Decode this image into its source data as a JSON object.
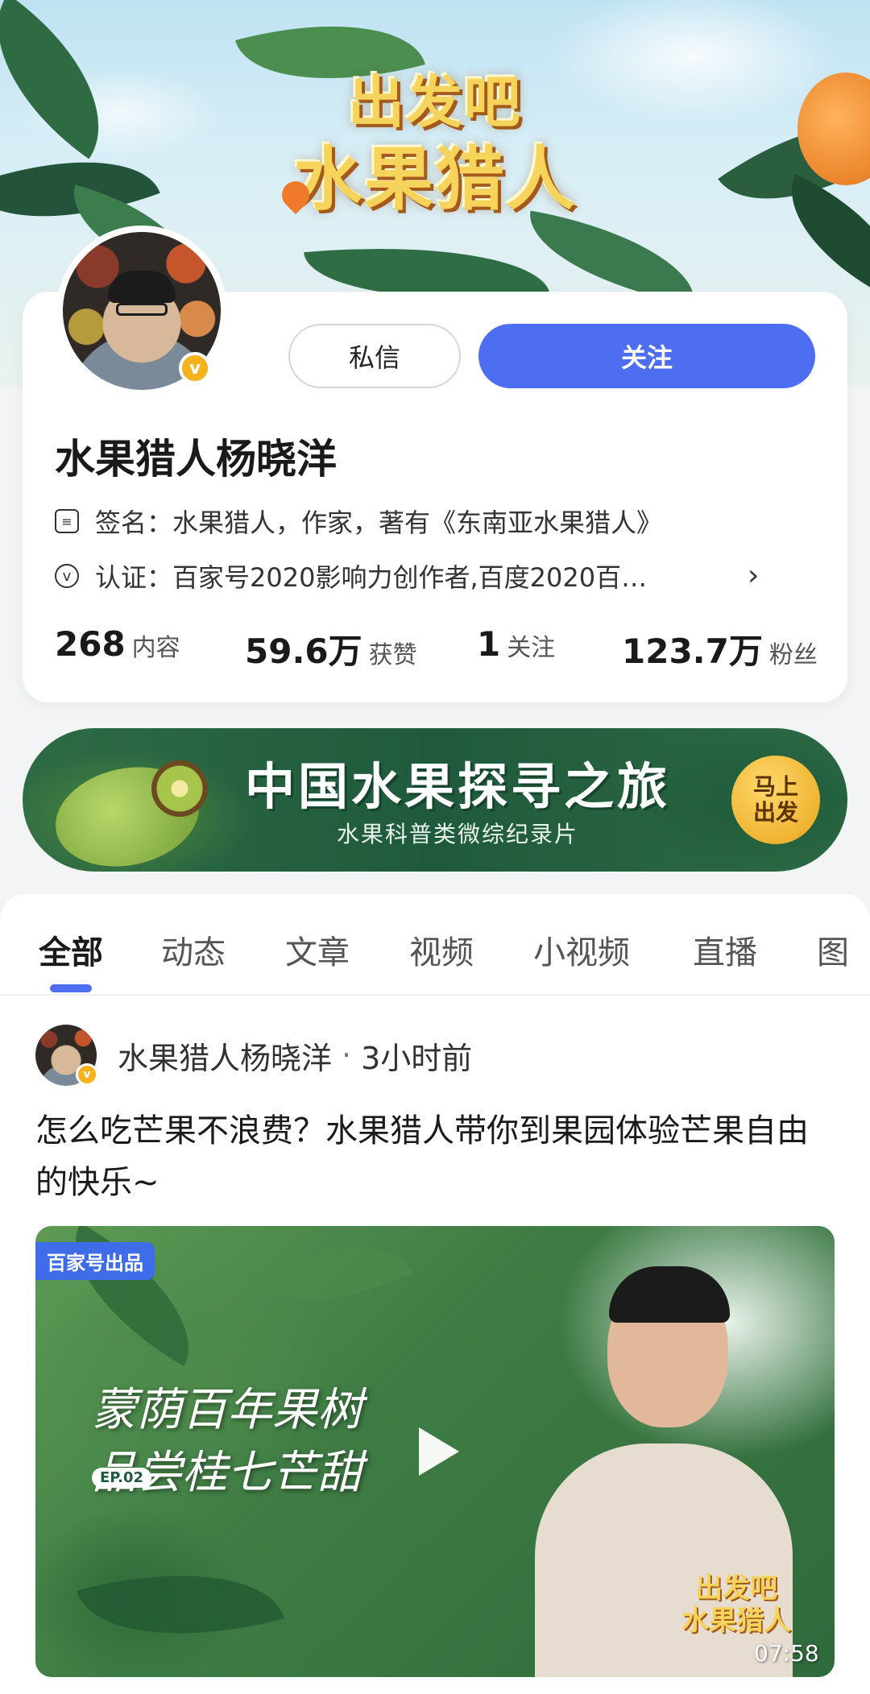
{
  "header": {
    "logo_line1": "出发吧",
    "logo_line2": "水果猎人"
  },
  "profile": {
    "message_button": "私信",
    "follow_button": "关注",
    "name": "水果猎人杨晓洋",
    "signature_label": "签名：",
    "signature_text": "水果猎人，作家，著有《东南亚水果猎人》",
    "cert_label": "认证：",
    "cert_text": "百家号2020影响力创作者,百度2020百…",
    "stats": [
      {
        "value": "268",
        "label": "内容"
      },
      {
        "value": "59.6万",
        "label": "获赞"
      },
      {
        "value": "1",
        "label": "关注"
      },
      {
        "value": "123.7万",
        "label": "粉丝"
      }
    ]
  },
  "promo": {
    "title": "中国水果探寻之旅",
    "subtitle": "水果科普类微综纪录片",
    "button_line1": "马上",
    "button_line2": "出发"
  },
  "tabs": [
    {
      "label": "全部",
      "active": true
    },
    {
      "label": "动态"
    },
    {
      "label": "文章"
    },
    {
      "label": "视频"
    },
    {
      "label": "小视频"
    },
    {
      "label": "直播"
    },
    {
      "label": "图"
    }
  ],
  "post": {
    "author": "水果猎人杨晓洋",
    "separator": "·",
    "time": "3小时前",
    "title": "怎么吃芒果不浪费？水果猎人带你到果园体验芒果自由的快乐~",
    "video": {
      "badge": "百家号出品",
      "caption_line1": "蒙荫百年果树",
      "caption_line2": "品尝桂七芒甜",
      "episode": "EP.02",
      "logo_line1": "出发吧",
      "logo_line2": "水果猎人",
      "duration": "07:58"
    }
  },
  "colors": {
    "accent": "#4e6ef2",
    "verified": "#f5b21b",
    "promo_green": "#1f5a3d"
  }
}
